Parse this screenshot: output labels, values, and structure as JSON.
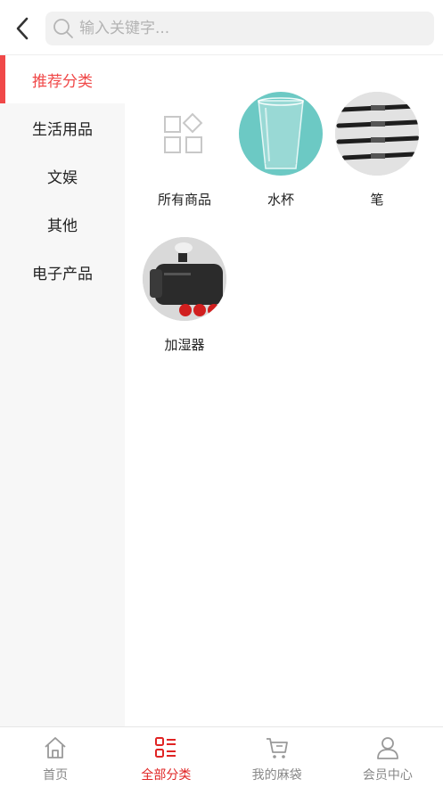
{
  "header": {
    "search_placeholder": "输入关键字..."
  },
  "sidebar": {
    "items": [
      {
        "label": "推荐分类",
        "active": true
      },
      {
        "label": "生活用品"
      },
      {
        "label": "文娱"
      },
      {
        "label": "其他"
      },
      {
        "label": "电子产品"
      }
    ]
  },
  "categories": [
    {
      "label": "所有商品",
      "icon": "grid-icon"
    },
    {
      "label": "水杯",
      "icon": "cup-image"
    },
    {
      "label": "笔",
      "icon": "pen-image"
    },
    {
      "label": "加湿器",
      "icon": "humidifier-image"
    }
  ],
  "tabbar": {
    "tabs": [
      {
        "label": "首页",
        "icon": "home-icon"
      },
      {
        "label": "全部分类",
        "icon": "category-icon",
        "active": true
      },
      {
        "label": "我的麻袋",
        "icon": "cart-icon"
      },
      {
        "label": "会员中心",
        "icon": "user-icon"
      }
    ]
  },
  "colors": {
    "accent": "#f04848",
    "tab_active": "#e02424",
    "sidebar_bg": "#f7f7f7",
    "cup_bg": "#6cc9c4"
  }
}
